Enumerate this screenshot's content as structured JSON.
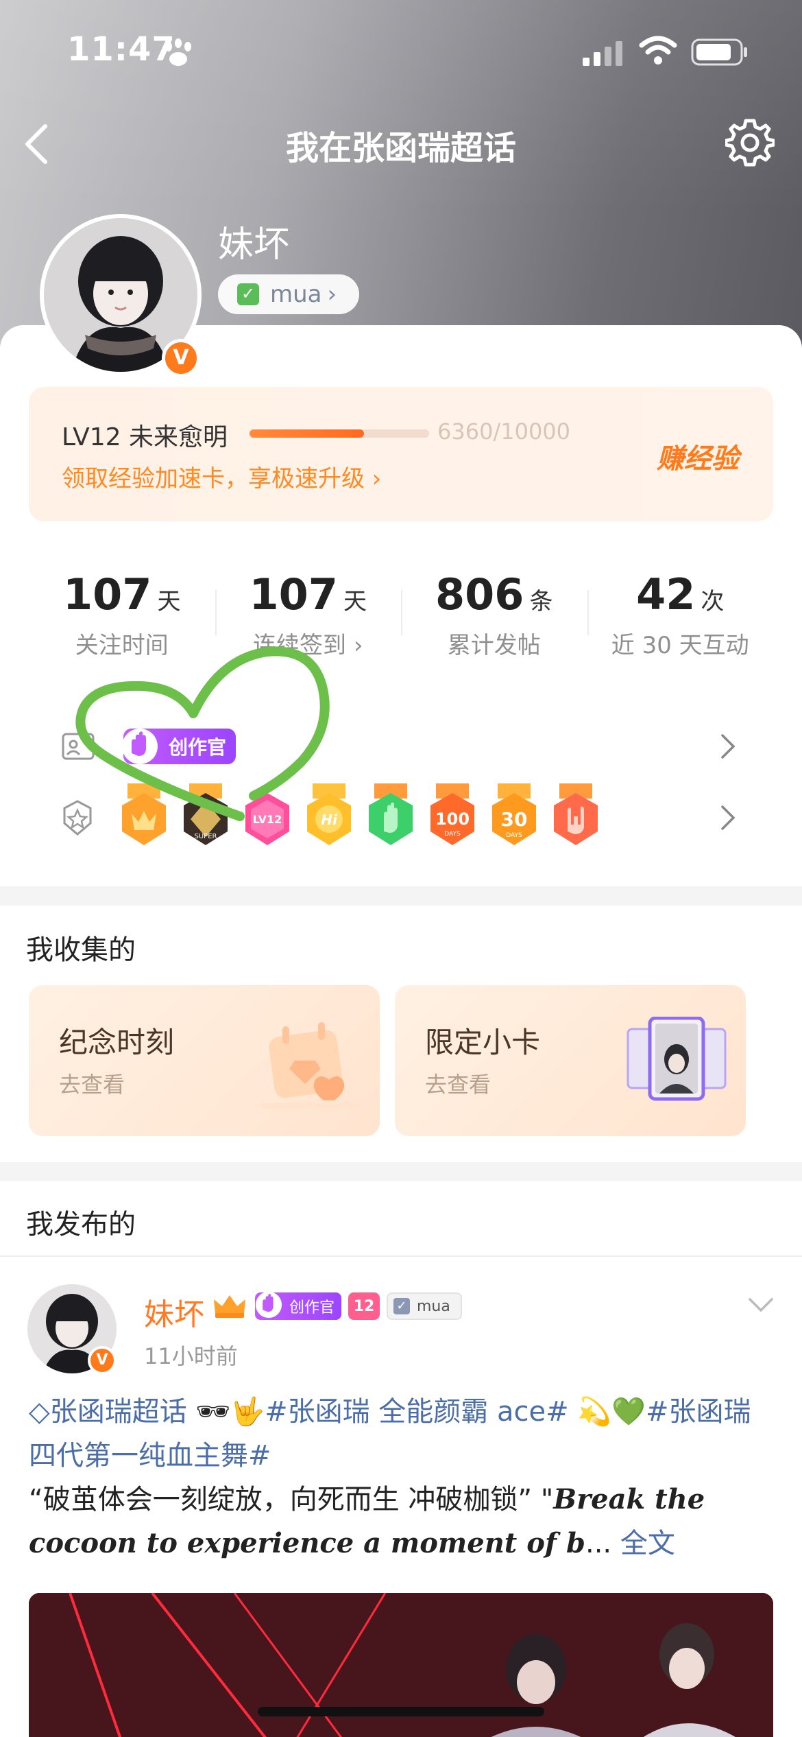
{
  "status_bar": {
    "time": "11:47"
  },
  "nav": {
    "title": "我在张函瑞超话"
  },
  "profile": {
    "name": "妹坏",
    "tag": "mua",
    "verified_mark": "V"
  },
  "level": {
    "label": "LV12 未来愈明",
    "progress_text": "6360/10000",
    "progress_fraction": 0.636,
    "promo": "领取经验加速卡，享极速升级 ›",
    "earn_label": "赚经验"
  },
  "stats": [
    {
      "value": "107",
      "unit": "天",
      "label": "关注时间"
    },
    {
      "value": "107",
      "unit": "天",
      "label": "连续签到 ›"
    },
    {
      "value": "806",
      "unit": "条",
      "label": "累计发帖"
    },
    {
      "value": "42",
      "unit": "次",
      "label": "近 30 天互动"
    }
  ],
  "badges": {
    "creator_label": "创作官",
    "medal_icons": [
      "crown-medal",
      "super-medal",
      "lv12-medal",
      "hi-medal",
      "hand-medal",
      "100-days-medal",
      "30-days-medal",
      "rock-hand-medal"
    ]
  },
  "collections": {
    "title": "我收集的",
    "items": [
      {
        "title": "纪念时刻",
        "sub": "去查看"
      },
      {
        "title": "限定小卡",
        "sub": "去查看"
      }
    ]
  },
  "posts_section": {
    "title": "我发布的"
  },
  "post": {
    "author": "妹坏",
    "time": "11小时前",
    "creator_label": "创作官",
    "tag_label": "mua",
    "level_badge": "12",
    "topic": "张函瑞超话",
    "hashtag1": "#张函瑞 全能颜霸 ace#",
    "hashtag2": "#张函瑞 四代第一纯血主舞#",
    "quote_cn": "“破茧体会一刻绽放，向死而生 冲破枷锁” \"",
    "quote_en": "Break the cocoon to experience a moment of b",
    "ellipsis": "...",
    "more": "全文"
  },
  "colors": {
    "accent": "#ff7a1a",
    "link": "#4b6ea8",
    "creator": "#a64cff",
    "scribble": "#6cc04a"
  }
}
